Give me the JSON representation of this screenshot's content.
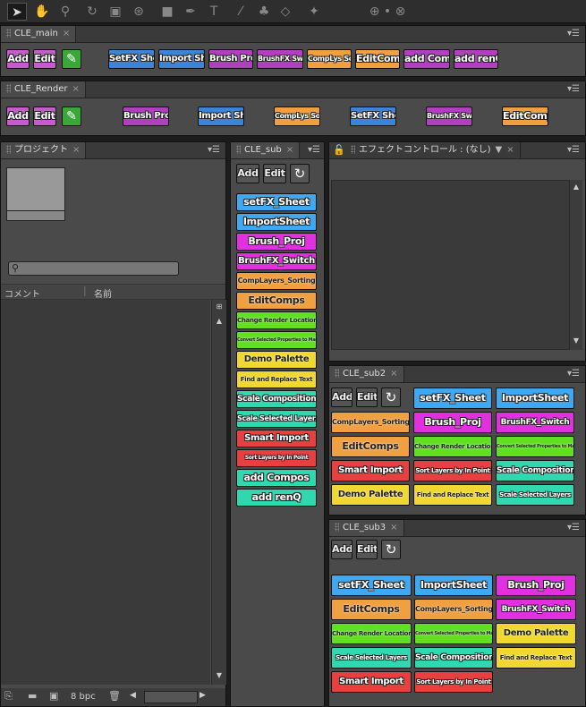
{
  "toolbar": {
    "icons": [
      "selection-tool-icon",
      "hand-tool-icon",
      "zoom-tool-icon",
      "rotate-tool-icon",
      "camera-tool-icon",
      "pan-behind-tool-icon",
      "shape-tool-icon",
      "pen-tool-icon",
      "type-tool-icon",
      "brush-tool-icon",
      "clone-stamp-tool-icon",
      "eraser-tool-icon",
      "puppet-tool-icon",
      "axis-icon"
    ]
  },
  "cle_main": {
    "tab": "CLE_main",
    "buttons": [
      "Add",
      "Edit",
      "SetFX Sheet",
      "Import Sheet",
      "Brush Proj",
      "BrushFX Switch",
      "CompLys Sorting",
      "EditComps",
      "add Comps",
      "add renQ"
    ]
  },
  "cle_render": {
    "tab": "CLE_Render",
    "buttons": [
      "Add",
      "Edit",
      "Brush Proj",
      "Import Sheet",
      "CompLys Sorting",
      "SetFX Sheet",
      "BrushFX Switch",
      "EditComps"
    ]
  },
  "project": {
    "tab": "プロジェクト",
    "col_comment": "コメント",
    "col_name": "名前",
    "bpc": "8 bpc"
  },
  "cle_sub": {
    "tab": "CLE_sub",
    "add": "Add",
    "edit": "Edit",
    "buttons": [
      "setFX_Sheet",
      "ImportSheet",
      "Brush_Proj",
      "BrushFX_Switch",
      "CompLayers_Sorting",
      "EditComps",
      "Change Render Locations",
      "Convert Selected Properties to Markers",
      "Demo Palette",
      "Find and Replace Text",
      "Scale Composition",
      "Scale Selected Layers",
      "Smart Import",
      "Sort Layers by In Point",
      "add Compos",
      "add renQ"
    ]
  },
  "effect": {
    "tab": "エフェクトコントロール : (なし)"
  },
  "cle_sub2": {
    "tab": "CLE_sub2",
    "add": "Add",
    "edit": "Edit",
    "buttons": [
      "setFX_Sheet",
      "ImportSheet",
      "CompLayers_Sorting",
      "Brush_Proj",
      "BrushFX_Switch",
      "EditComps",
      "Change Render Locations",
      "Convert Selected Properties to Markers",
      "Smart Import",
      "Sort Layers by In Point",
      "Scale Composition",
      "Demo Palette",
      "Find and Replace Text",
      "Scale Selected Layers"
    ]
  },
  "cle_sub3": {
    "tab": "CLE_sub3",
    "add": "Add",
    "edit": "Edit",
    "buttons": [
      "setFX_Sheet",
      "ImportSheet",
      "Brush_Proj",
      "EditComps",
      "CompLayers_Sorting",
      "BrushFX_Switch",
      "Change Render Locations",
      "Convert Selected Properties to Markers",
      "Demo Palette",
      "Scale Selected Layers",
      "Scale Composition",
      "Find and Replace Text",
      "Smart Import",
      "Sort Layers by In Point"
    ]
  },
  "colors": {
    "pink": "#d25ad8",
    "blue": "#3c84d8",
    "magenta": "#e030e0",
    "purple": "#b040c0",
    "orange": "#f0a040",
    "lightorange": "#f5b060",
    "green": "#60e020",
    "yellow": "#f0d830",
    "cyan": "#30d8b0",
    "red": "#e84040",
    "sky": "#40a8f0"
  }
}
